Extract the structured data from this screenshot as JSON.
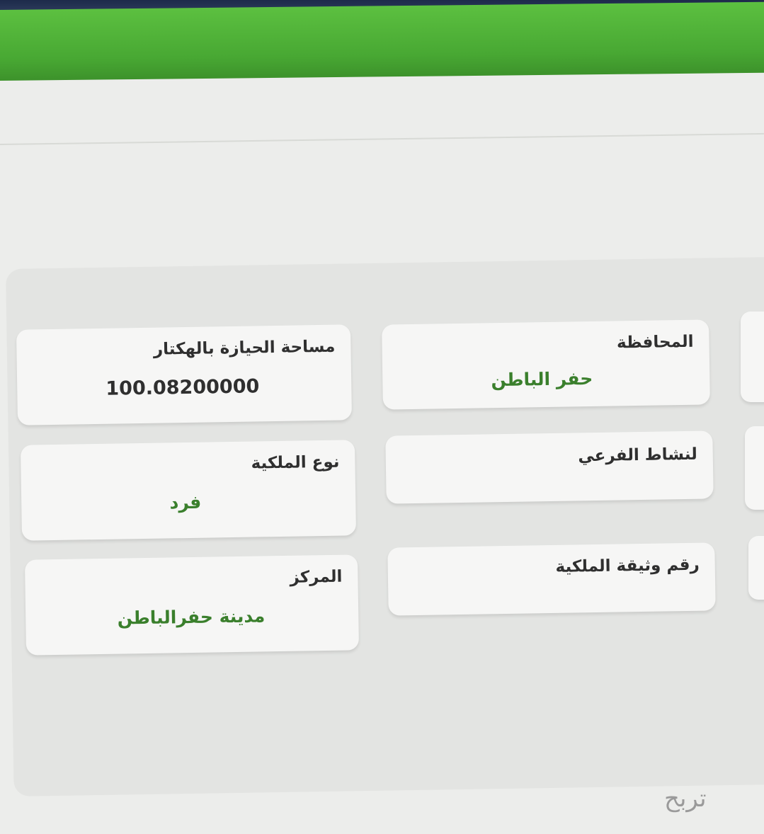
{
  "fields": {
    "area": {
      "label": "مساحة الحيازة بالهكتار",
      "value": "100.08200000"
    },
    "governorate": {
      "label": "المحافظة",
      "value": "حفر الباطن"
    },
    "ownership_type": {
      "label": "نوع الملكية",
      "value": "فرد"
    },
    "sub_activity": {
      "label": "لنشاط الفرعي",
      "value": ""
    },
    "center": {
      "label": "المركز",
      "value": "مدينة حفرالباطن"
    },
    "deed_number": {
      "label": "رقم وثيقة الملكية",
      "value": ""
    }
  },
  "watermark": "تربح",
  "colors": {
    "header_green": "#4cae36",
    "header_navy": "#1d2a4a",
    "value_green": "#3a7f2c"
  }
}
